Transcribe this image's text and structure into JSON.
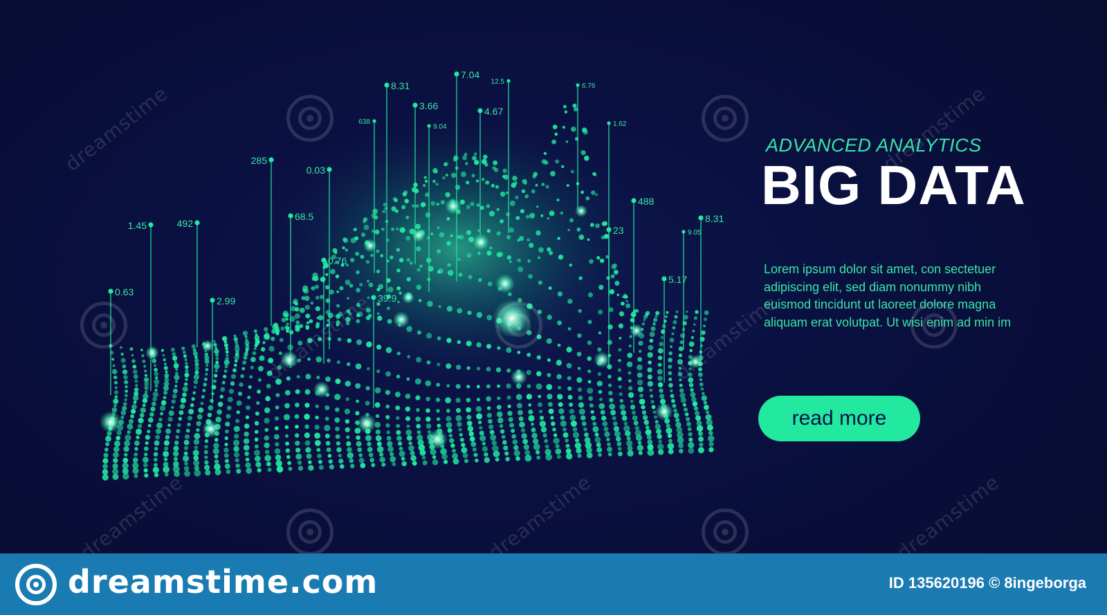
{
  "hero": {
    "kicker": "ADVANCED ANALYTICS",
    "headline": "BIG DATA",
    "body_lines": [
      "Lorem ipsum dolor sit amet, con sectetuer",
      "adipiscing elit, sed diam nonummy nibh",
      "euismod tincidunt  ut laoreet dolore magna",
      "aliquam erat volutpat. Ut wisi enim ad min  im"
    ],
    "cta_label": "read more"
  },
  "data_markers": [
    {
      "label": "8.31"
    },
    {
      "label": "7.04"
    },
    {
      "label": "12.5"
    },
    {
      "label": "6.76"
    },
    {
      "label": "3.66"
    },
    {
      "label": "638"
    },
    {
      "label": "9.04"
    },
    {
      "label": "4.67"
    },
    {
      "label": "1.62"
    },
    {
      "label": "285"
    },
    {
      "label": "0.03"
    },
    {
      "label": "488"
    },
    {
      "label": "1.45"
    },
    {
      "label": "492"
    },
    {
      "label": "68.5"
    },
    {
      "label": "23"
    },
    {
      "label": "9.05"
    },
    {
      "label": "8.31"
    },
    {
      "label": "0.63"
    },
    {
      "label": "2.99"
    },
    {
      "label": "5.17"
    },
    {
      "label": "39.9"
    },
    {
      "label": "0.76"
    }
  ],
  "watermark": {
    "text": "dreamstime"
  },
  "footer": {
    "brand": "dreamstime.com",
    "id_text": "ID 135620196 © 8ingeborga"
  },
  "colors": {
    "background": "#0a0f33",
    "accent": "#22e8a0",
    "text_accent": "#38e7a6",
    "footer": "#1a7bb2"
  }
}
